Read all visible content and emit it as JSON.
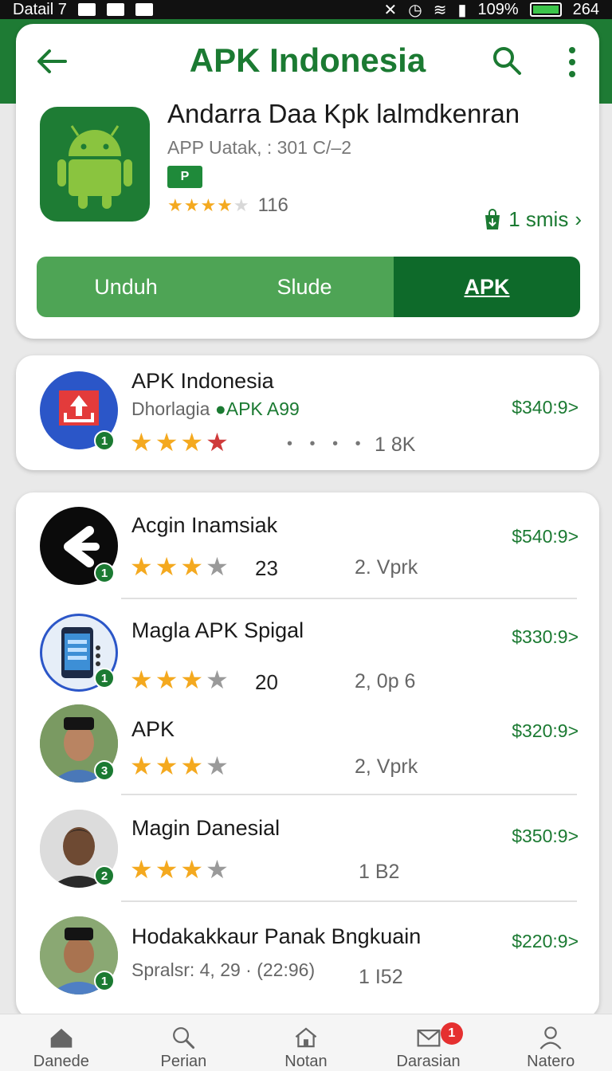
{
  "status": {
    "carrier": "Datail 7",
    "battery": "109%",
    "time": "264"
  },
  "header": {
    "title": "APK Indonesia"
  },
  "app": {
    "name": "Andarra Daa Kpk lalmdkenran",
    "meta": "APP Uatak, : 301 C/–2",
    "badge": "P",
    "rating_count": "116",
    "downloads": "1 smis"
  },
  "segments": [
    "Unduh",
    "Slude",
    "APK"
  ],
  "featured": {
    "title": "APK Indonesia",
    "sub": "Dhorlagia",
    "sub_accent": "APK A99",
    "rank": "1",
    "meta": "1 8K",
    "price": "$340:9>"
  },
  "list": [
    {
      "title": "Acgin Inamsiak",
      "rank": "1",
      "rating": "23",
      "meta": "2. Vprk",
      "price": "$540:9>"
    },
    {
      "title": "Magla APK Spigal",
      "rank": "1",
      "rating": "20",
      "meta": "2, 0p 6",
      "price": "$330:9>"
    },
    {
      "title": "APK",
      "rank": "3",
      "rating": "",
      "meta": "2, Vprk",
      "price": "$320:9>"
    },
    {
      "title": "Magin Danesial",
      "rank": "2",
      "rating": "",
      "meta": "1 B2",
      "price": "$350:9>"
    },
    {
      "title": "Hodakakkaur Panak Bngkuain",
      "rank": "1",
      "sub": "Spralsr: 4, 29 · (22:96)",
      "meta": "1 I52",
      "price": "$220:9>"
    }
  ],
  "nav": [
    {
      "label": "Danede",
      "icon": "home-icon"
    },
    {
      "label": "Perian",
      "icon": "search-icon"
    },
    {
      "label": "Notan",
      "icon": "house-icon"
    },
    {
      "label": "Darasian",
      "icon": "mail-icon",
      "badge": "1"
    },
    {
      "label": "Natero",
      "icon": "person-icon"
    }
  ],
  "colors": {
    "brand": "#1b7a32",
    "accent": "#4ea455",
    "star": "#f4a91f"
  }
}
